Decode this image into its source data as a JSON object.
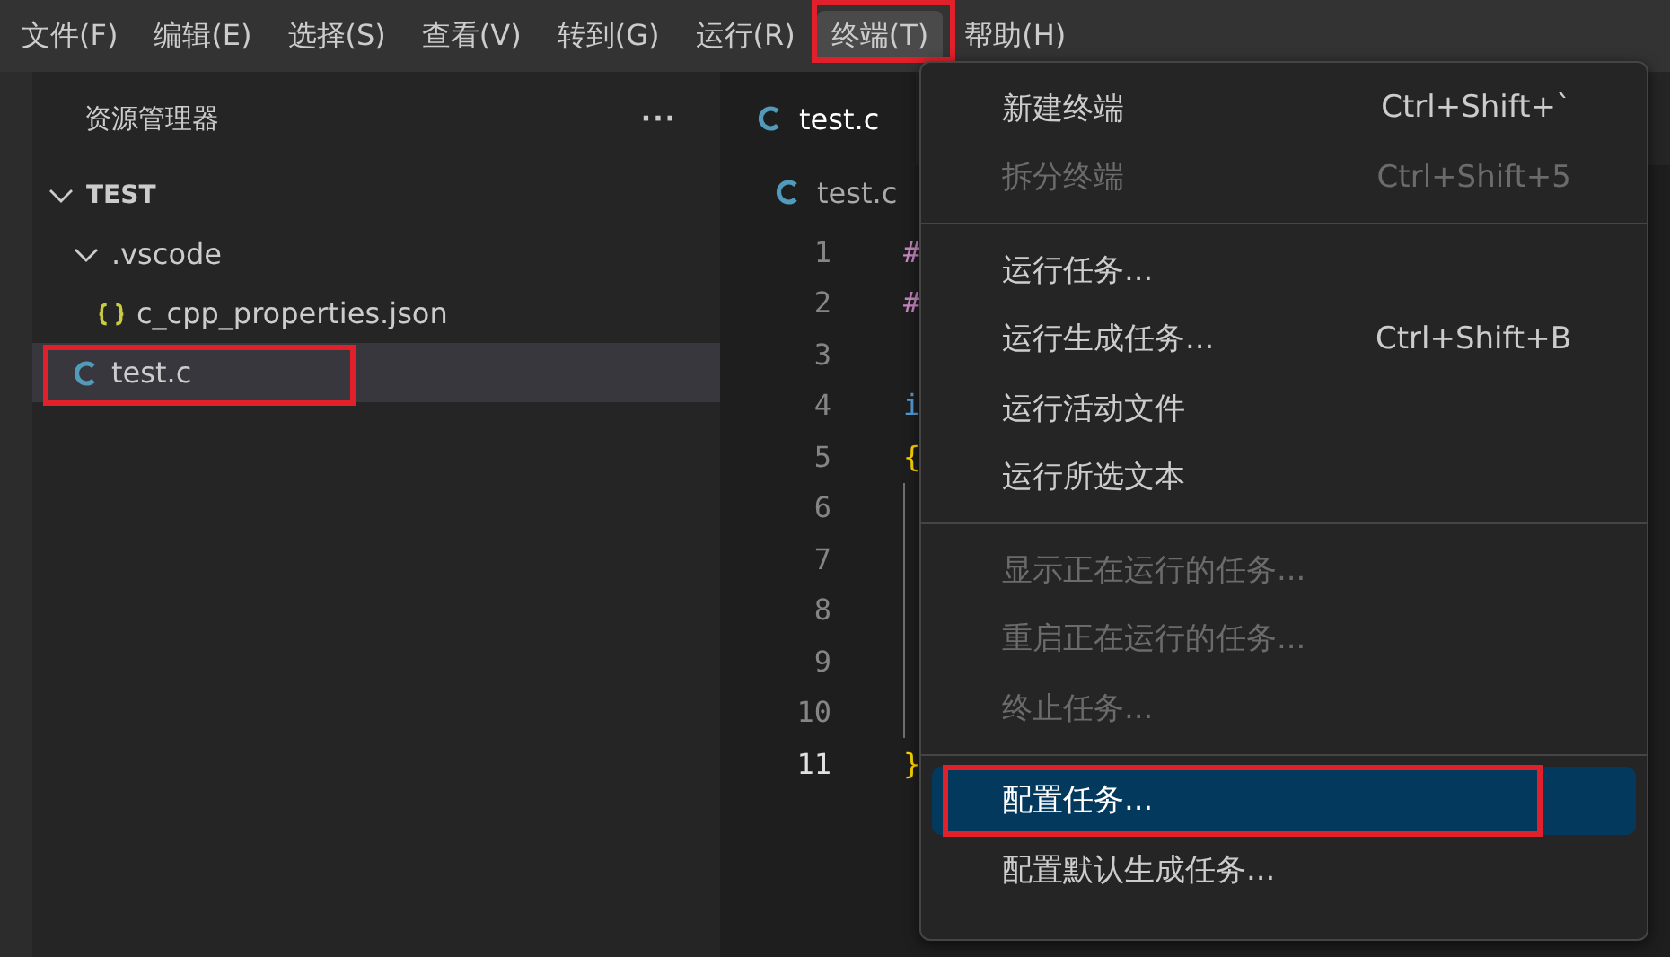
{
  "menu_bar": [
    {
      "label": "文件(F)",
      "selected": false,
      "annotated": false
    },
    {
      "label": "编辑(E)",
      "selected": false,
      "annotated": false
    },
    {
      "label": "选择(S)",
      "selected": false,
      "annotated": false
    },
    {
      "label": "查看(V)",
      "selected": false,
      "annotated": false
    },
    {
      "label": "转到(G)",
      "selected": false,
      "annotated": false
    },
    {
      "label": "运行(R)",
      "selected": false,
      "annotated": false
    },
    {
      "label": "终端(T)",
      "selected": true,
      "annotated": true
    },
    {
      "label": "帮助(H)",
      "selected": false,
      "annotated": false
    }
  ],
  "sidebar": {
    "title": "资源管理器",
    "more": "···",
    "tree": [
      {
        "label": "TEST",
        "kind": "root",
        "expanded": true,
        "selected": false,
        "annotated": false,
        "children": [
          {
            "label": ".vscode",
            "kind": "folder",
            "expanded": true,
            "selected": false,
            "annotated": false,
            "children": [
              {
                "label": "c_cpp_properties.json",
                "kind": "json",
                "selected": false,
                "annotated": false
              }
            ]
          },
          {
            "label": "test.c",
            "kind": "c",
            "selected": true,
            "annotated": true
          }
        ]
      }
    ]
  },
  "editor": {
    "tab": "test.c",
    "breadcrumb": "test.c",
    "lines": [
      {
        "number": "1",
        "code": "#",
        "kind": "directive",
        "current": false
      },
      {
        "number": "2",
        "code": "#",
        "kind": "directive",
        "current": false
      },
      {
        "number": "3",
        "kind": "plain",
        "current": false
      },
      {
        "number": "4",
        "code": "i",
        "kind": "keyword",
        "current": false
      },
      {
        "number": "5",
        "code": "{",
        "kind": "brace",
        "current": false
      },
      {
        "number": "6",
        "kind": "indented",
        "current": false
      },
      {
        "number": "7",
        "kind": "indented",
        "current": false
      },
      {
        "number": "8",
        "kind": "indented",
        "current": false
      },
      {
        "number": "9",
        "kind": "indented",
        "current": false
      },
      {
        "number": "10",
        "kind": "indented",
        "current": false
      },
      {
        "number": "11",
        "code": "}",
        "kind": "brace",
        "current": true
      }
    ]
  },
  "dropdown_menu": {
    "groups": [
      [
        {
          "label": "新建终端",
          "shortcut": "Ctrl+Shift+`",
          "disabled": false,
          "selected": false,
          "annotated": false
        },
        {
          "label": "拆分终端",
          "shortcut": "Ctrl+Shift+5",
          "disabled": true,
          "selected": false,
          "annotated": false
        }
      ],
      [
        {
          "label": "运行任务...",
          "disabled": false,
          "selected": false,
          "annotated": false
        },
        {
          "label": "运行生成任务...",
          "shortcut": "Ctrl+Shift+B",
          "disabled": false,
          "selected": false,
          "annotated": false
        },
        {
          "label": "运行活动文件",
          "disabled": false,
          "selected": false,
          "annotated": false
        },
        {
          "label": "运行所选文本",
          "disabled": false,
          "selected": false,
          "annotated": false
        }
      ],
      [
        {
          "label": "显示正在运行的任务...",
          "disabled": true,
          "selected": false,
          "annotated": false
        },
        {
          "label": "重启正在运行的任务...",
          "disabled": true,
          "selected": false,
          "annotated": false
        },
        {
          "label": "终止任务...",
          "disabled": true,
          "selected": false,
          "annotated": false
        }
      ],
      [
        {
          "label": "配置任务...",
          "disabled": false,
          "selected": true,
          "annotated": true
        },
        {
          "label": "配置默认生成任务...",
          "disabled": false,
          "selected": false,
          "annotated": false
        }
      ]
    ]
  }
}
